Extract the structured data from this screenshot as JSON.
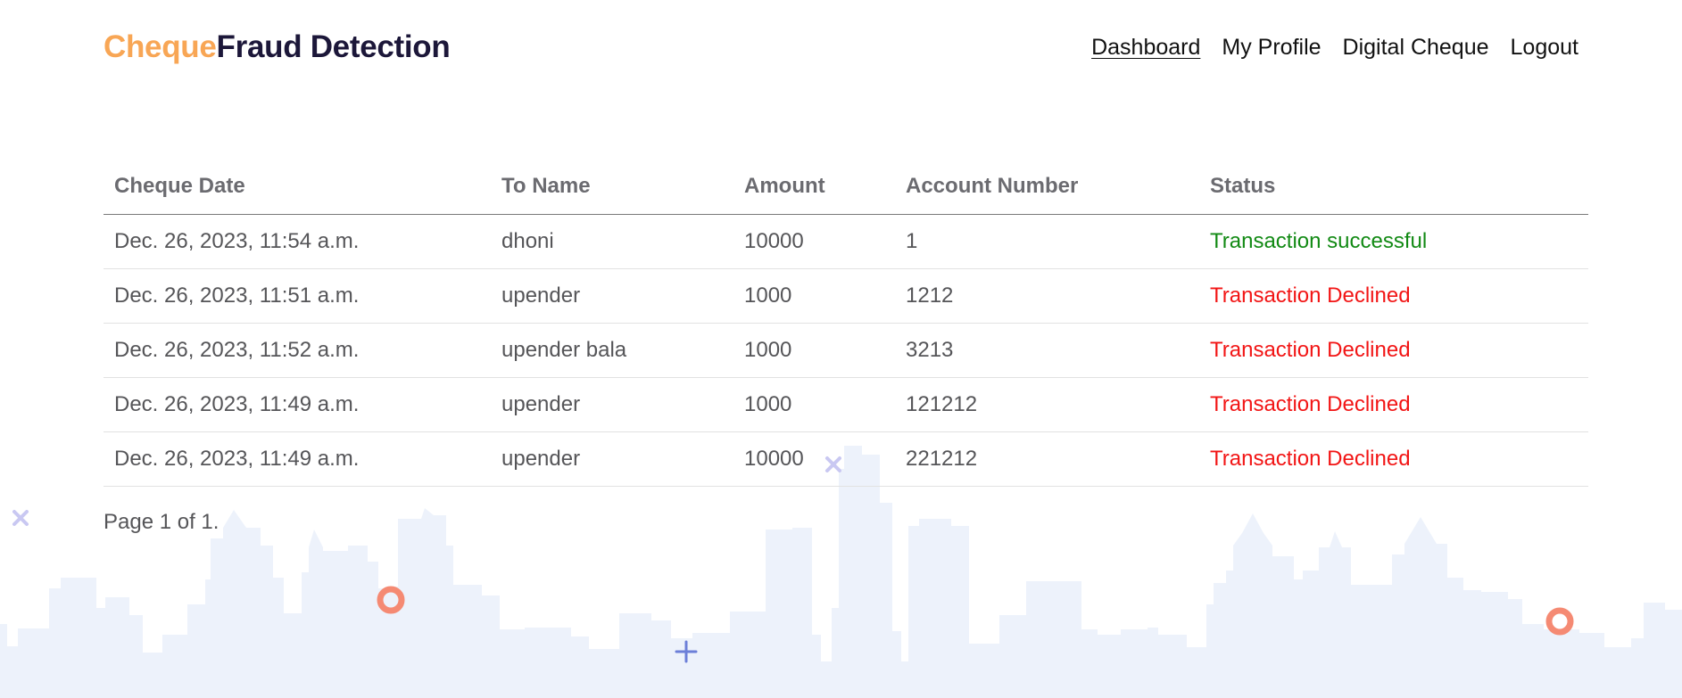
{
  "brand": {
    "accent": "Cheque",
    "main": "Fraud Detection"
  },
  "nav": {
    "items": [
      {
        "label": "Dashboard",
        "active": true
      },
      {
        "label": "My Profile"
      },
      {
        "label": "Digital Cheque"
      },
      {
        "label": "Logout"
      }
    ]
  },
  "table": {
    "headers": [
      "Cheque Date",
      "To Name",
      "Amount",
      "Account Number",
      "Status"
    ],
    "rows": [
      {
        "date": "Dec. 26, 2023, 11:54 a.m.",
        "to_name": "dhoni",
        "amount": "10000",
        "account": "1",
        "status": "Transaction successful",
        "status_type": "ok"
      },
      {
        "date": "Dec. 26, 2023, 11:51 a.m.",
        "to_name": "upender",
        "amount": "1000",
        "account": "1212",
        "status": "Transaction Declined",
        "status_type": "bad"
      },
      {
        "date": "Dec. 26, 2023, 11:52 a.m.",
        "to_name": "upender bala",
        "amount": "1000",
        "account": "3213",
        "status": "Transaction Declined",
        "status_type": "bad"
      },
      {
        "date": "Dec. 26, 2023, 11:49 a.m.",
        "to_name": "upender",
        "amount": "1000",
        "account": "121212",
        "status": "Transaction Declined",
        "status_type": "bad"
      },
      {
        "date": "Dec. 26, 2023, 11:49 a.m.",
        "to_name": "upender",
        "amount": "10000",
        "account": "221212",
        "status": "Transaction Declined",
        "status_type": "bad"
      }
    ]
  },
  "pagination": {
    "text": "Page 1 of 1."
  },
  "colors": {
    "brand_accent": "#f8a655",
    "brand_main": "#1c1739",
    "status_success": "#128a14",
    "status_declined": "#f21515",
    "skyline": "#edf2fb"
  },
  "decorations": [
    "city-skyline-illustration",
    "cross-icon",
    "ring-icon",
    "plus-icon"
  ]
}
